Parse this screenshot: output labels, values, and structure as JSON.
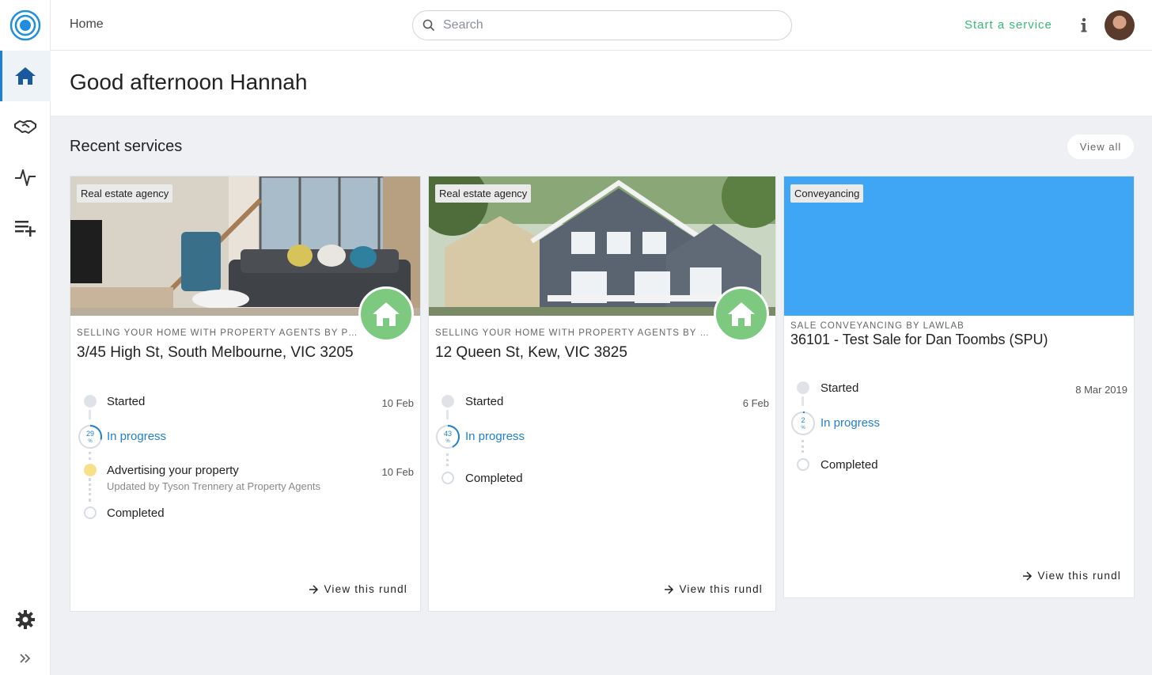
{
  "topbar": {
    "breadcrumb": "Home",
    "search_placeholder": "Search",
    "start_service_label": "Start a service"
  },
  "greeting": "Good afternoon Hannah",
  "recent": {
    "title": "Recent services",
    "view_all_label": "View all"
  },
  "cards": [
    {
      "tag": "Real estate agency",
      "service_type": "SELLING YOUR HOME WITH PROPERTY AGENTS BY PROPE...",
      "title": "3/45 High St, South Melbourne, VIC 3205",
      "timeline": {
        "started_label": "Started",
        "started_date": "10 Feb",
        "progress_percent": "29",
        "progress_unit": "%",
        "in_progress_label": "In progress",
        "event_label": "Advertising your property",
        "event_date": "10 Feb",
        "event_sub": "Updated by Tyson Trennery at Property Agents",
        "completed_label": "Completed"
      },
      "view_label": "View this rundl"
    },
    {
      "tag": "Real estate agency",
      "service_type": "SELLING YOUR HOME WITH PROPERTY AGENTS BY PROP...",
      "title": "12 Queen St, Kew, VIC 3825",
      "timeline": {
        "started_label": "Started",
        "started_date": "6 Feb",
        "progress_percent": "43",
        "progress_unit": "%",
        "in_progress_label": "In progress",
        "completed_label": "Completed"
      },
      "view_label": "View this rundl"
    },
    {
      "tag": "Conveyancing",
      "service_type": "SALE CONVEYANCING BY LAWLAB",
      "title": "36101 - Test Sale for Dan Toombs (SPU)",
      "timeline": {
        "started_label": "Started",
        "started_date": "8 Mar 2019",
        "progress_percent": "2",
        "progress_unit": "%",
        "in_progress_label": "In progress",
        "completed_label": "Completed"
      },
      "view_label": "View this rundl"
    }
  ],
  "colors": {
    "accent_blue": "#1f7fd1",
    "start_green": "#3ab87a",
    "house_badge_green": "#7cc97f",
    "conveyancing_blue": "#3ea6f5"
  },
  "icons": {
    "sidebar": [
      "home-icon",
      "handshake-icon",
      "activity-icon",
      "playlist-add-icon",
      "gear-icon",
      "double-chevron-right-icon"
    ]
  }
}
